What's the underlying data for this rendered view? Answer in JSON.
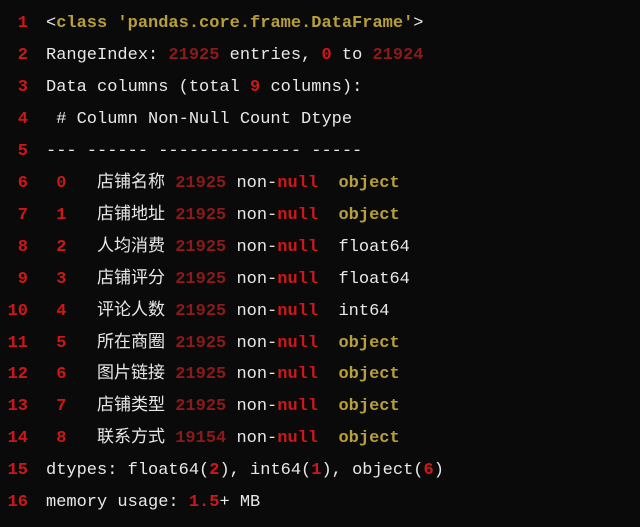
{
  "line1": {
    "no": "1",
    "lt": "<",
    "cls": "class",
    "sp": " ",
    "q1": "'",
    "mod": "pandas.core.frame.DataFrame",
    "q2": "'",
    "gt": ">"
  },
  "line2": {
    "no": "2",
    "label": "RangeIndex: ",
    "total": "21925",
    "mid": " entries, ",
    "zero": "0",
    "to": " to ",
    "max": "21924"
  },
  "line3": {
    "no": "3",
    "a": "Data columns (total ",
    "n": "9",
    "b": " columns):"
  },
  "line4": {
    "no": "4",
    "txt": " # Column Non-Null Count Dtype"
  },
  "line5": {
    "no": "5",
    "txt": "--- ------ -------------- -----"
  },
  "cols": [
    {
      "no": "6",
      "idx": "0",
      "name": "店铺名称",
      "cnt": "21925",
      "dtype": "object",
      "olive": true
    },
    {
      "no": "7",
      "idx": "1",
      "name": "店铺地址",
      "cnt": "21925",
      "dtype": "object",
      "olive": true
    },
    {
      "no": "8",
      "idx": "2",
      "name": "人均消费",
      "cnt": "21925",
      "dtype": "float64",
      "olive": false
    },
    {
      "no": "9",
      "idx": "3",
      "name": "店铺评分",
      "cnt": "21925",
      "dtype": "float64",
      "olive": false
    },
    {
      "no": "10",
      "idx": "4",
      "name": "评论人数",
      "cnt": "21925",
      "dtype": "int64",
      "olive": false
    },
    {
      "no": "11",
      "idx": "5",
      "name": "所在商圈",
      "cnt": "21925",
      "dtype": "object",
      "olive": true
    },
    {
      "no": "12",
      "idx": "6",
      "name": "图片链接",
      "cnt": "21925",
      "dtype": "object",
      "olive": true
    },
    {
      "no": "13",
      "idx": "7",
      "name": "店铺类型",
      "cnt": "21925",
      "dtype": "object",
      "olive": true
    },
    {
      "no": "14",
      "idx": "8",
      "name": "联系方式",
      "cnt": "19154",
      "dtype": "object",
      "olive": true
    }
  ],
  "non": "non-",
  "null": "null",
  "sp3": "   ",
  "sp1": "  ",
  "line15": {
    "no": "15",
    "a": "dtypes: float64(",
    "f": "2",
    "b": "), int64(",
    "i": "1",
    "c": "), object(",
    "o": "6",
    "d": ")"
  },
  "line16": {
    "no": "16",
    "a": "memory usage: ",
    "m": "1.5",
    "b": "+ MB"
  }
}
